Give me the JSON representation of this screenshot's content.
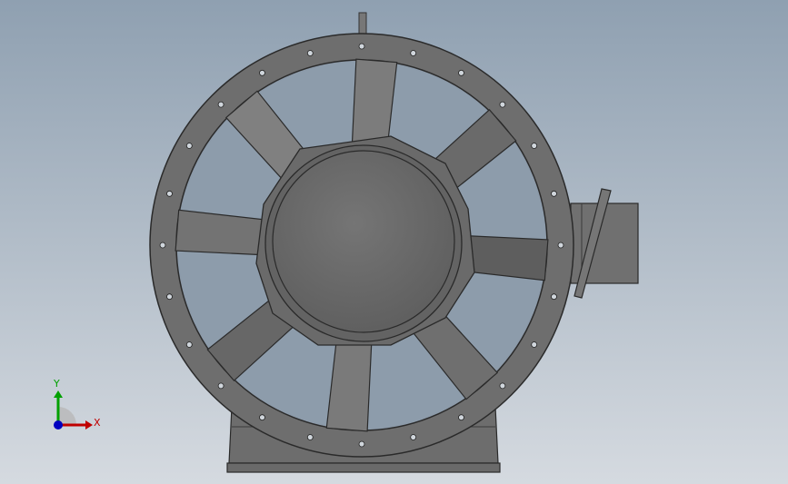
{
  "viewport": {
    "background_top": "#8fa0b1",
    "background_bottom": "#d5dae0"
  },
  "model": {
    "name_icon": "axial-fan-icon",
    "body_color": "#6f6f6f",
    "blade_color": "#7a7a7a",
    "hub_color": "#666666",
    "edge_color": "#2a2a2a",
    "blade_count": 8,
    "bolt_hole_count": 24
  },
  "triad": {
    "x_label": "X",
    "y_label": "Y",
    "x_color": "#c00000",
    "y_color": "#00a000",
    "z_color": "#0000c0"
  }
}
